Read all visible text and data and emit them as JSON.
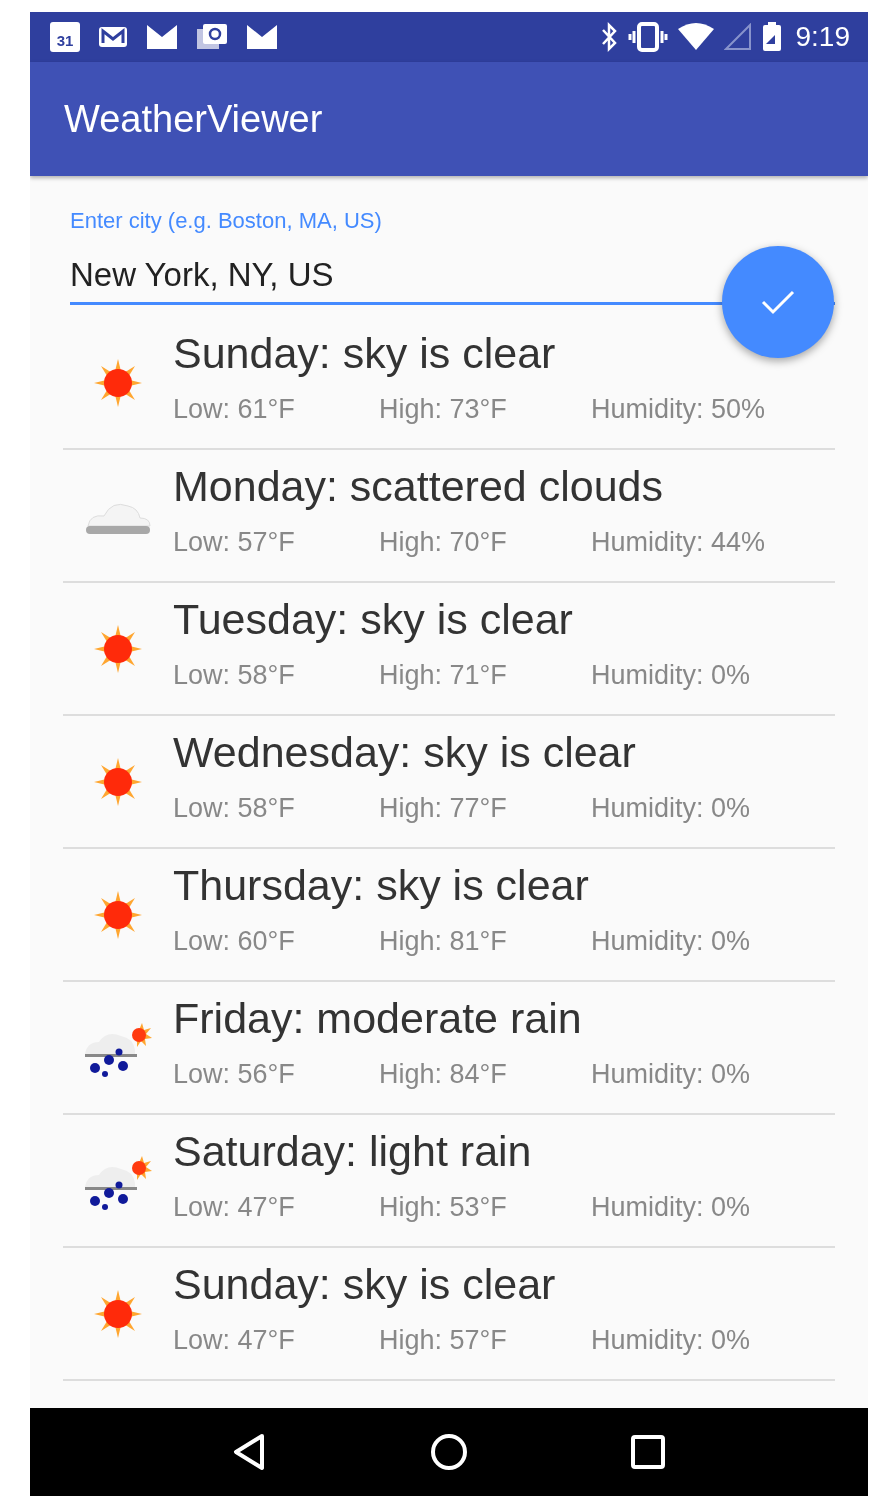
{
  "status_bar": {
    "calendar_day": "31",
    "time": "9:19"
  },
  "app_bar": {
    "title": "WeatherViewer"
  },
  "city_field": {
    "label": "Enter city (e.g. Boston, MA, US)",
    "value": "New York, NY, US"
  },
  "forecast": [
    {
      "kind": "sun",
      "title": "Sunday: sky is clear",
      "low": "Low: 61°F",
      "high": "High: 73°F",
      "humidity": "Humidity: 50%"
    },
    {
      "kind": "clouds",
      "title": "Monday: scattered clouds",
      "low": "Low: 57°F",
      "high": "High: 70°F",
      "humidity": "Humidity: 44%"
    },
    {
      "kind": "sun",
      "title": "Tuesday: sky is clear",
      "low": "Low: 58°F",
      "high": "High: 71°F",
      "humidity": "Humidity: 0%"
    },
    {
      "kind": "sun",
      "title": "Wednesday: sky is clear",
      "low": "Low: 58°F",
      "high": "High: 77°F",
      "humidity": "Humidity: 0%"
    },
    {
      "kind": "sun",
      "title": "Thursday: sky is clear",
      "low": "Low: 60°F",
      "high": "High: 81°F",
      "humidity": "Humidity: 0%"
    },
    {
      "kind": "rain",
      "title": "Friday: moderate rain",
      "low": "Low: 56°F",
      "high": "High: 84°F",
      "humidity": "Humidity: 0%"
    },
    {
      "kind": "rain",
      "title": "Saturday: light rain",
      "low": "Low: 47°F",
      "high": "High: 53°F",
      "humidity": "Humidity: 0%"
    },
    {
      "kind": "sun",
      "title": "Sunday: sky is clear",
      "low": "Low: 47°F",
      "high": "High: 57°F",
      "humidity": "Humidity: 0%"
    }
  ]
}
